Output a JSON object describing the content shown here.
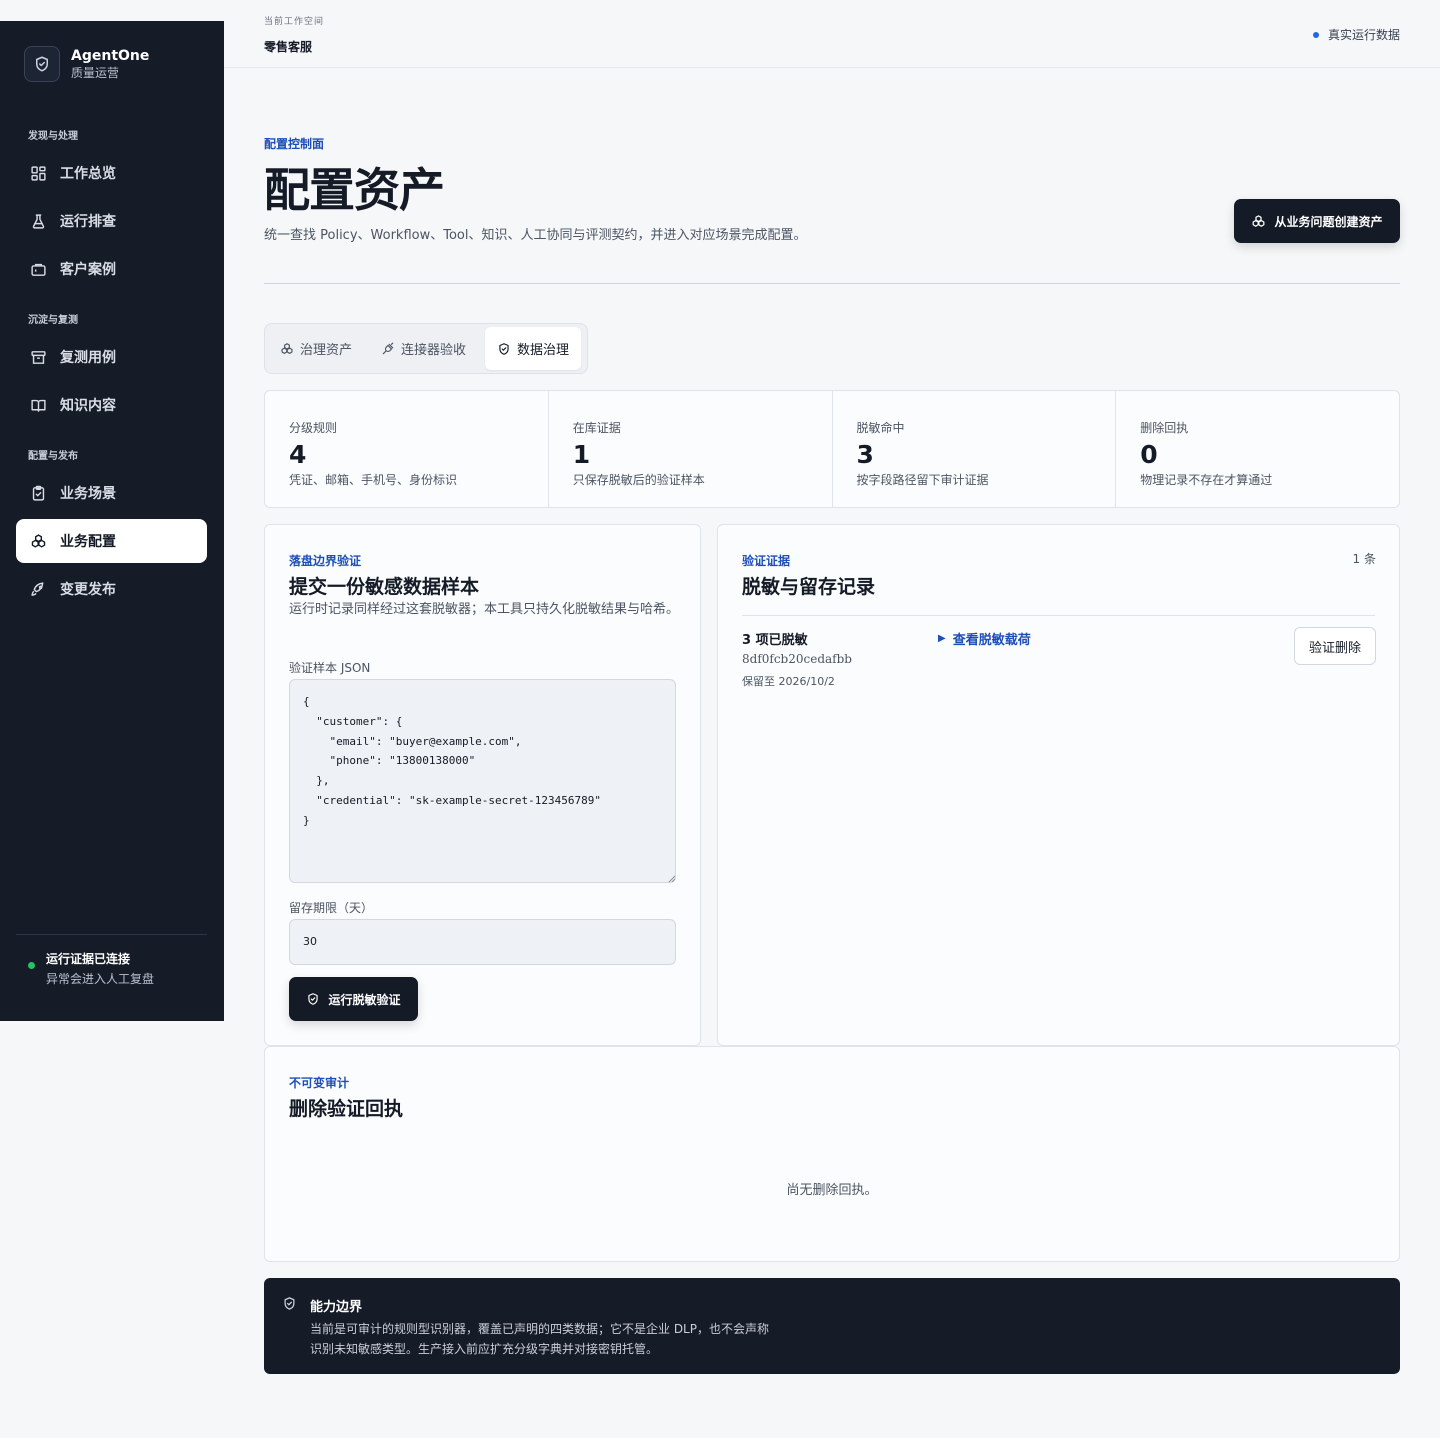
{
  "sidebar": {
    "brand": {
      "name": "AgentOne",
      "sub": "质量运营"
    },
    "sections": [
      {
        "title": "发现与处理"
      },
      {
        "title": "沉淀与复测"
      },
      {
        "title": "配置与发布"
      }
    ],
    "items": [
      {
        "label": "工作总览",
        "icon": "grid-icon"
      },
      {
        "label": "运行排查",
        "icon": "flask-icon"
      },
      {
        "label": "客户案例",
        "icon": "briefcase-icon"
      },
      {
        "label": "复测用例",
        "icon": "archive-icon"
      },
      {
        "label": "知识内容",
        "icon": "book-icon"
      },
      {
        "label": "业务场景",
        "icon": "clipboard-icon"
      },
      {
        "label": "业务配置",
        "icon": "boxes-icon",
        "active": true
      },
      {
        "label": "变更发布",
        "icon": "rocket-icon"
      }
    ],
    "connection": {
      "title": "运行证据已连接",
      "sub": "异常会进入人工复盘",
      "color": "#22c55e"
    }
  },
  "topbar": {
    "workspace_label": "当前工作空间",
    "workspace_name": "零售客服",
    "live_label": "真实运行数据"
  },
  "header": {
    "eyebrow": "配置控制面",
    "title": "配置资产",
    "description": "统一查找 Policy、Workflow、Tool、知识、人工协同与评测契约，并进入对应场景完成配置。",
    "cta": "从业务问题创建资产"
  },
  "tabs": [
    {
      "label": "治理资产",
      "icon": "boxes-icon"
    },
    {
      "label": "连接器验收",
      "icon": "plug-icon"
    },
    {
      "label": "数据治理",
      "icon": "shield-icon",
      "active": true
    }
  ],
  "stats": [
    {
      "label": "分级规则",
      "value": "4",
      "desc": "凭证、邮箱、手机号、身份标识"
    },
    {
      "label": "在库证据",
      "value": "1",
      "desc": "只保存脱敏后的验证样本"
    },
    {
      "label": "脱敏命中",
      "value": "3",
      "desc": "按字段路径留下审计证据"
    },
    {
      "label": "删除回执",
      "value": "0",
      "desc": "物理记录不存在才算通过"
    }
  ],
  "submit_card": {
    "eyebrow": "落盘边界验证",
    "title": "提交一份敏感数据样本",
    "description": "运行时记录同样经过这套脱敏器；本工具只持久化脱敏结果与哈希。",
    "json_label": "验证样本 JSON",
    "json_value": "{\n  \"customer\": {\n    \"email\": \"buyer@example.com\",\n    \"phone\": \"13800138000\"\n  },\n  \"credential\": \"sk-example-secret-123456789\"\n}",
    "retention_label": "留存期限（天）",
    "retention_value": "30",
    "run_button": "运行脱敏验证"
  },
  "evidence_card": {
    "eyebrow": "验证证据",
    "title": "脱敏与留存记录",
    "count": "1 条",
    "records": [
      {
        "title": "3 项已脱敏",
        "hash": "8df0fcb20cedafbb",
        "keep": "保留至 2026/10/2",
        "link": "查看脱敏载荷",
        "action": "验证删除"
      }
    ]
  },
  "audit_card": {
    "eyebrow": "不可变审计",
    "title": "删除验证回执",
    "empty": "尚无删除回执。"
  },
  "notice": {
    "title": "能力边界",
    "text": "当前是可审计的规则型识别器，覆盖已声明的四类数据；它不是企业 DLP，也不会声称识别未知敏感类型。生产接入前应扩充分级字典并对接密钥托管。"
  },
  "colors": {
    "accent": "#1e4fb8",
    "dark": "#151b27",
    "live": "#2563eb"
  }
}
